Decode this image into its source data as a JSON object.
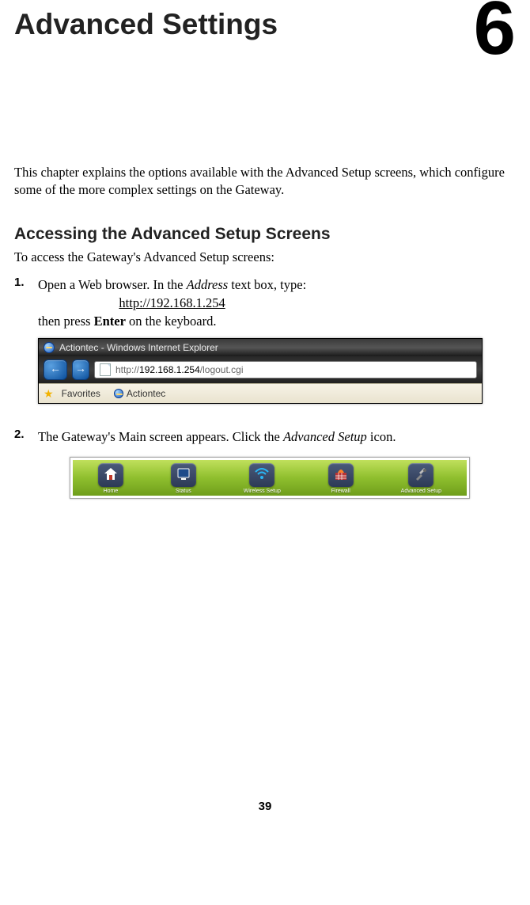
{
  "chapter": {
    "title": "Advanced Settings",
    "number": "6"
  },
  "intro": "This chapter explains the options available with the Advanced Setup screens, which configure some of the more complex settings on the Gateway.",
  "section_heading": "Accessing the Advanced Setup Screens",
  "section_intro": "To access the Gateway's Advanced Setup screens:",
  "step1": {
    "num": "1.",
    "line1a": "Open a Web browser. In the ",
    "line1b_italic": "Address",
    "line1c": " text box, type:",
    "url": "http://192.168.1.254",
    "line3a": "then press ",
    "line3b_bold": "Enter",
    "line3c": " on the keyboard."
  },
  "browser": {
    "window_title": "Actiontec - Windows Internet Explorer",
    "addr_prefix": "http://",
    "addr_host": "192.168.1.254",
    "addr_suffix": "/logout.cgi",
    "favorites_label": "Favorites",
    "fav_link_label": "Actiontec"
  },
  "step2": {
    "num": "2.",
    "texta": "The Gateway's Main screen appears. Click the ",
    "text_italic": "Advanced Setup",
    "textb": " icon."
  },
  "green_nav": {
    "items": [
      {
        "label": "Home"
      },
      {
        "label": "Status"
      },
      {
        "label": "Wireless Setup"
      },
      {
        "label": "Firewall"
      },
      {
        "label": "Advanced Setup"
      }
    ]
  },
  "page_number": "39"
}
